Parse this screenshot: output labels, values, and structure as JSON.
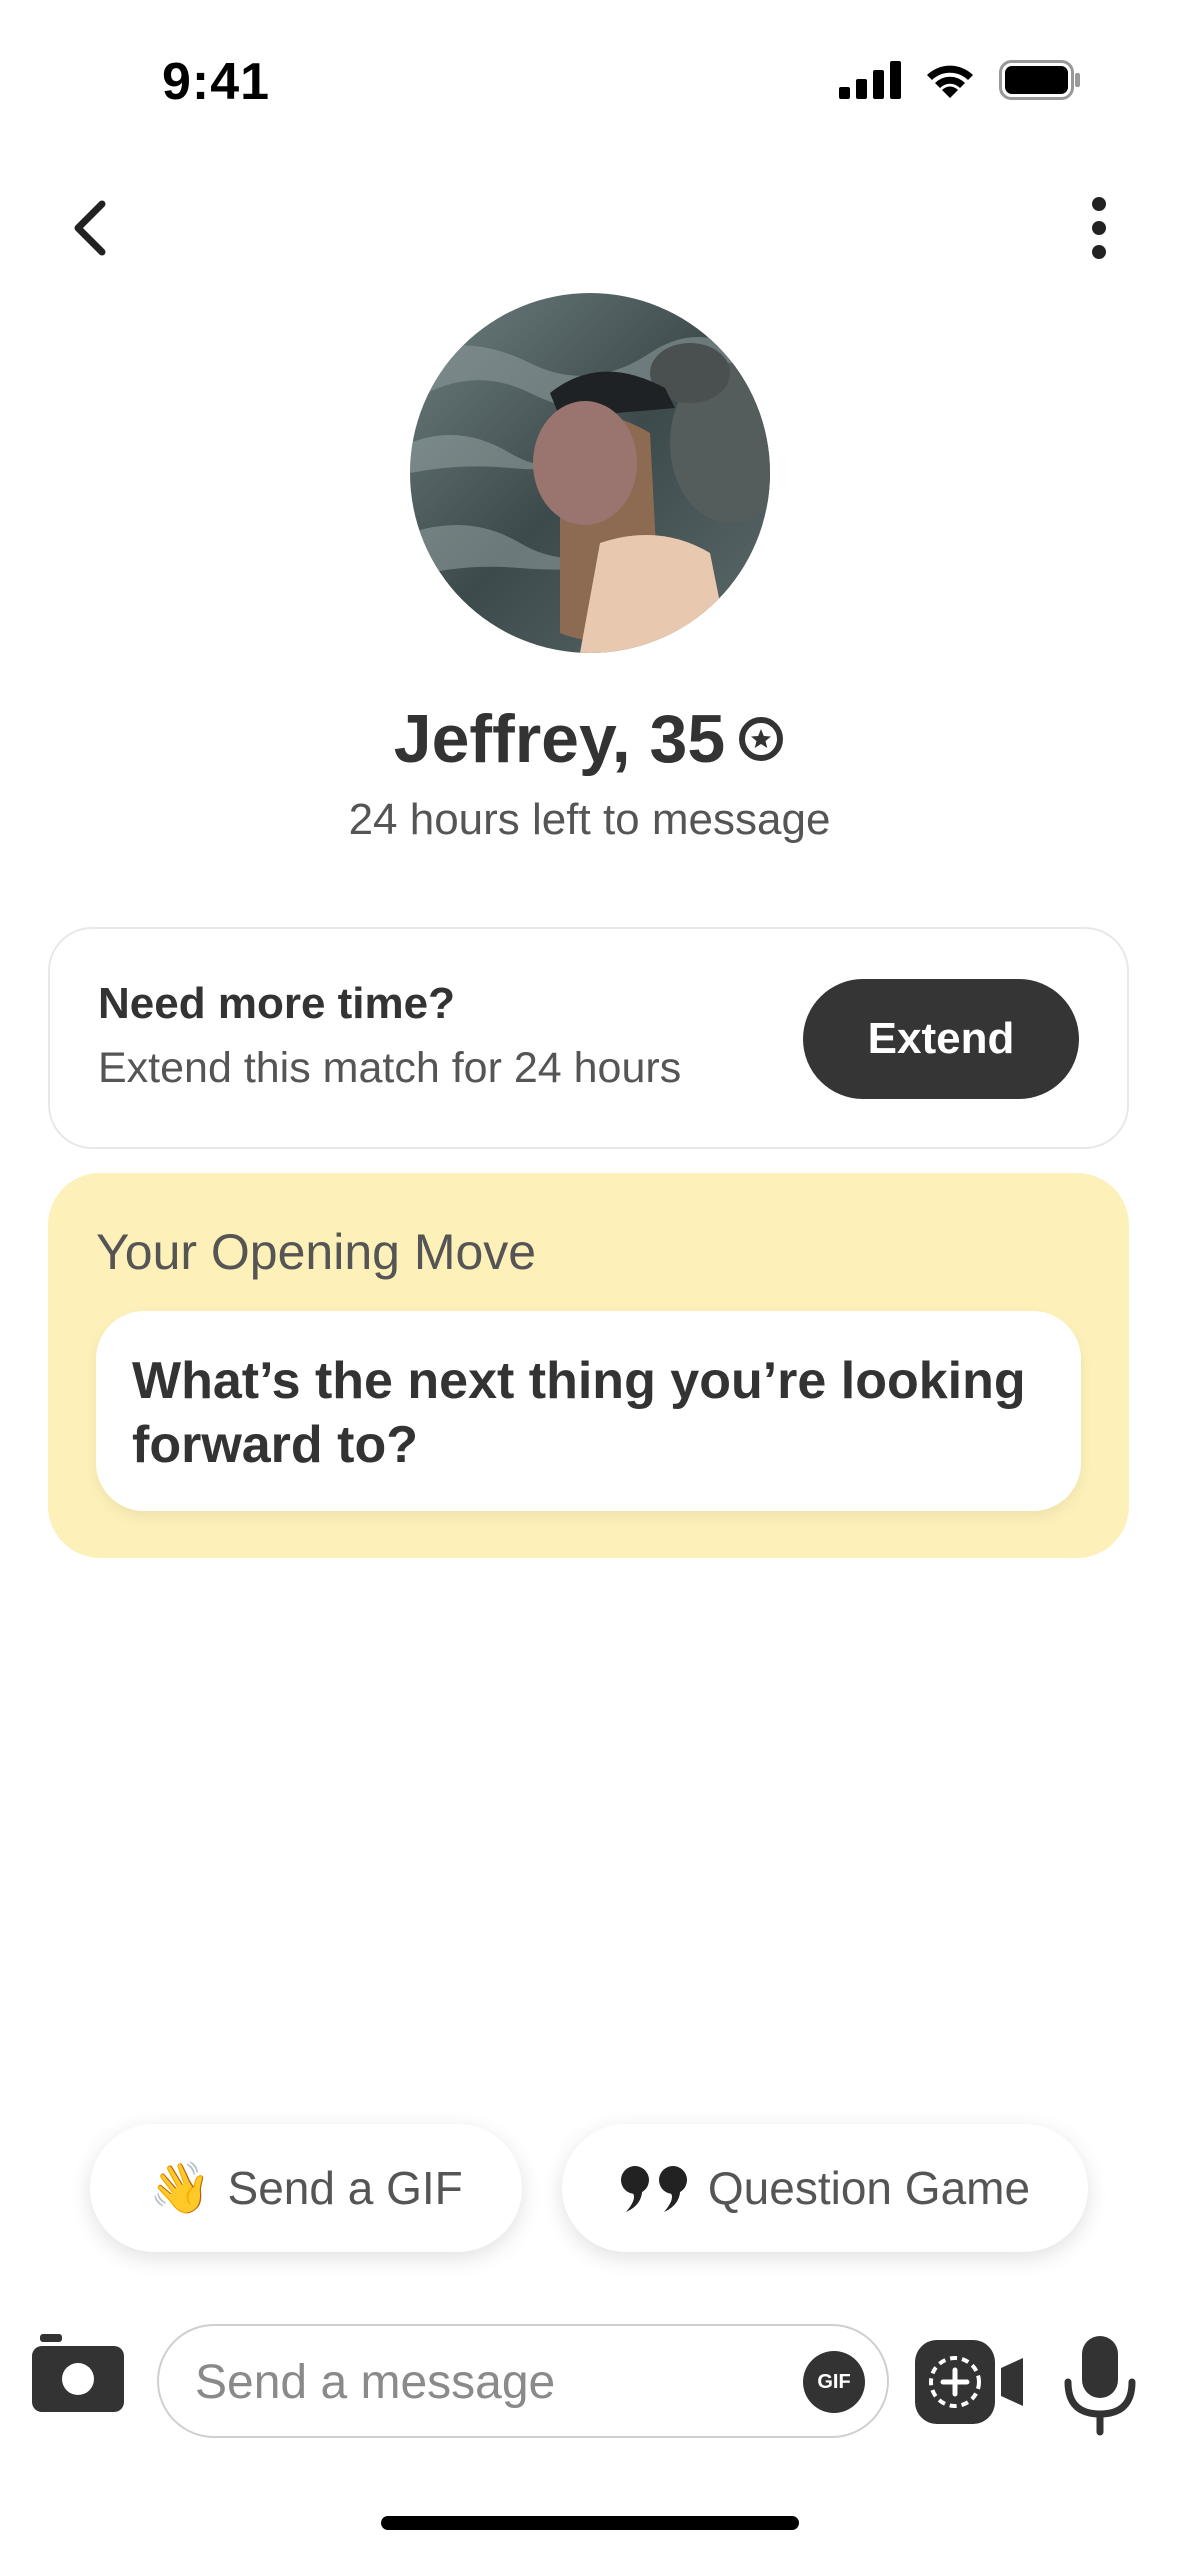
{
  "status_bar": {
    "time": "9:41"
  },
  "header": {
    "back_icon": "chevron-left-icon",
    "more_icon": "vertical-dots-icon"
  },
  "profile": {
    "name_age": "Jeffrey, 35",
    "verified_icon": "verified-badge-icon",
    "time_left": "24 hours left to message"
  },
  "extend_card": {
    "title": "Need more time?",
    "subtitle": "Extend this match for 24 hours",
    "button_label": "Extend"
  },
  "opening_move": {
    "title": "Your Opening Move",
    "question": "What’s the next thing you’re looking forward to?",
    "background_color": "#fdf0b8"
  },
  "chips": {
    "gif": {
      "emoji": "👋",
      "label": "Send a GIF"
    },
    "question_game": {
      "icon": "quote-icon",
      "label": "Question Game"
    }
  },
  "composer": {
    "placeholder": "Send a message",
    "gif_badge": "GIF"
  }
}
